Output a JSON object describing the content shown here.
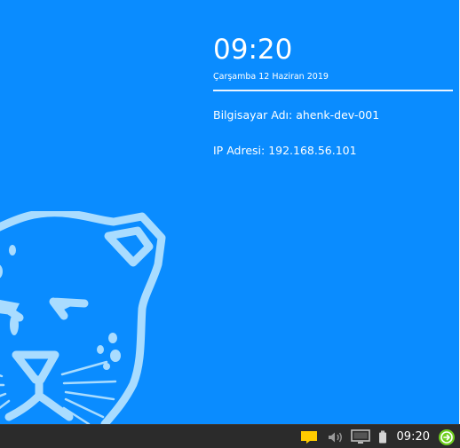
{
  "widget": {
    "time": "09:20",
    "date": "Çarşamba 12 Haziran 2019",
    "computer_name": "Bilgisayar Adı: ahenk-dev-001",
    "ip_address": "IP Adresi: 192.168.56.101"
  },
  "taskbar": {
    "clock": "09:20",
    "icons": [
      "sticky-notes-icon",
      "volume-icon",
      "network-monitor-icon",
      "battery-icon",
      "logout-icon"
    ]
  },
  "wallpaper": {
    "logo": "pardus-leopard-logo"
  },
  "colors": {
    "desktop_background": "#0a8cff",
    "logo_stroke": "#a9dcff",
    "taskbar_background": "#2b2b2b",
    "notes_yellow": "#ffcc00",
    "logout_green": "#6fcf1f"
  }
}
